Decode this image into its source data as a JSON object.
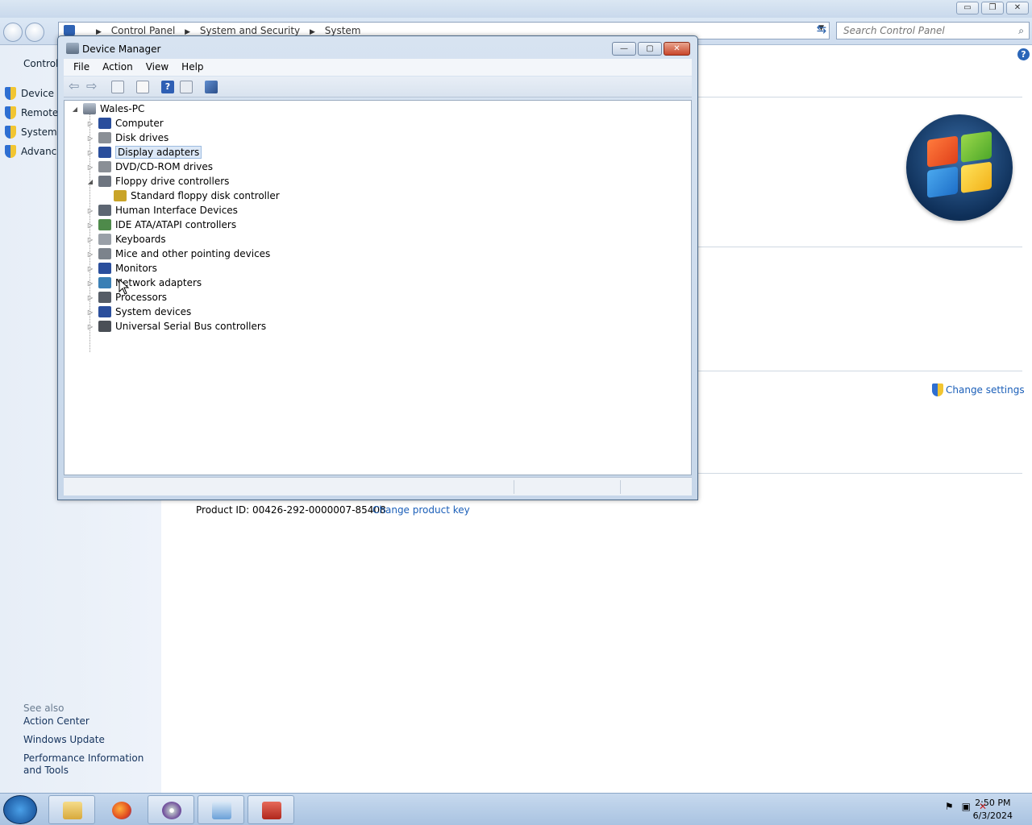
{
  "control_panel": {
    "breadcrumb": [
      "Control Panel",
      "System and Security",
      "System"
    ],
    "search_placeholder": "Search Control Panel",
    "window_buttons": {
      "minimize": "▭",
      "restore": "❐",
      "close": "✕"
    },
    "left_nav": {
      "home_label": "Control",
      "items": [
        "Device M",
        "Remote",
        "System",
        "Advanc"
      ],
      "see_also_label": "See also",
      "see_also_links": [
        "Action Center",
        "Windows Update",
        "Performance Information and Tools"
      ]
    },
    "change_settings_label": "Change settings",
    "product_id": "Product ID: 00426-292-0000007-85408",
    "change_product_key_label": "Change product key"
  },
  "device_manager": {
    "title": "Device Manager",
    "menu": [
      "File",
      "Action",
      "View",
      "Help"
    ],
    "window_buttons": {
      "minimize": "—",
      "restore": "▢",
      "close": "✕"
    },
    "root": "Wales-PC",
    "nodes": [
      {
        "label": "Computer",
        "expander": "▷",
        "icon_color": "#2a4e9c"
      },
      {
        "label": "Disk drives",
        "expander": "▷",
        "icon_color": "#8a8f96"
      },
      {
        "label": "Display adapters",
        "expander": "▷",
        "icon_color": "#2a4e9c",
        "selected": true
      },
      {
        "label": "DVD/CD-ROM drives",
        "expander": "▷",
        "icon_color": "#8a8f96"
      },
      {
        "label": "Floppy drive controllers",
        "expander": "◢",
        "icon_color": "#6e7580"
      },
      {
        "label": "Standard floppy disk controller",
        "expander": "",
        "icon_color": "#c9a428",
        "child": true
      },
      {
        "label": "Human Interface Devices",
        "expander": "▷",
        "icon_color": "#5d6672"
      },
      {
        "label": "IDE ATA/ATAPI controllers",
        "expander": "▷",
        "icon_color": "#4e8a4a"
      },
      {
        "label": "Keyboards",
        "expander": "▷",
        "icon_color": "#9aa0a8"
      },
      {
        "label": "Mice and other pointing devices",
        "expander": "▷",
        "icon_color": "#7c838c"
      },
      {
        "label": "Monitors",
        "expander": "▷",
        "icon_color": "#2a4e9c"
      },
      {
        "label": "Network adapters",
        "expander": "▷",
        "icon_color": "#3a7fb5"
      },
      {
        "label": "Processors",
        "expander": "▷",
        "icon_color": "#555c66"
      },
      {
        "label": "System devices",
        "expander": "▷",
        "icon_color": "#2a4e9c"
      },
      {
        "label": "Universal Serial Bus controllers",
        "expander": "▷",
        "icon_color": "#4a4f56"
      }
    ]
  },
  "taskbar": {
    "time": "2:50 PM",
    "date": "6/3/2024",
    "apps": [
      "windows-explorer",
      "firefox",
      "media-player",
      "control-panel",
      "toolbox"
    ]
  },
  "colors": {
    "link": "#1a5eb8",
    "selection": "#dce8f7"
  }
}
